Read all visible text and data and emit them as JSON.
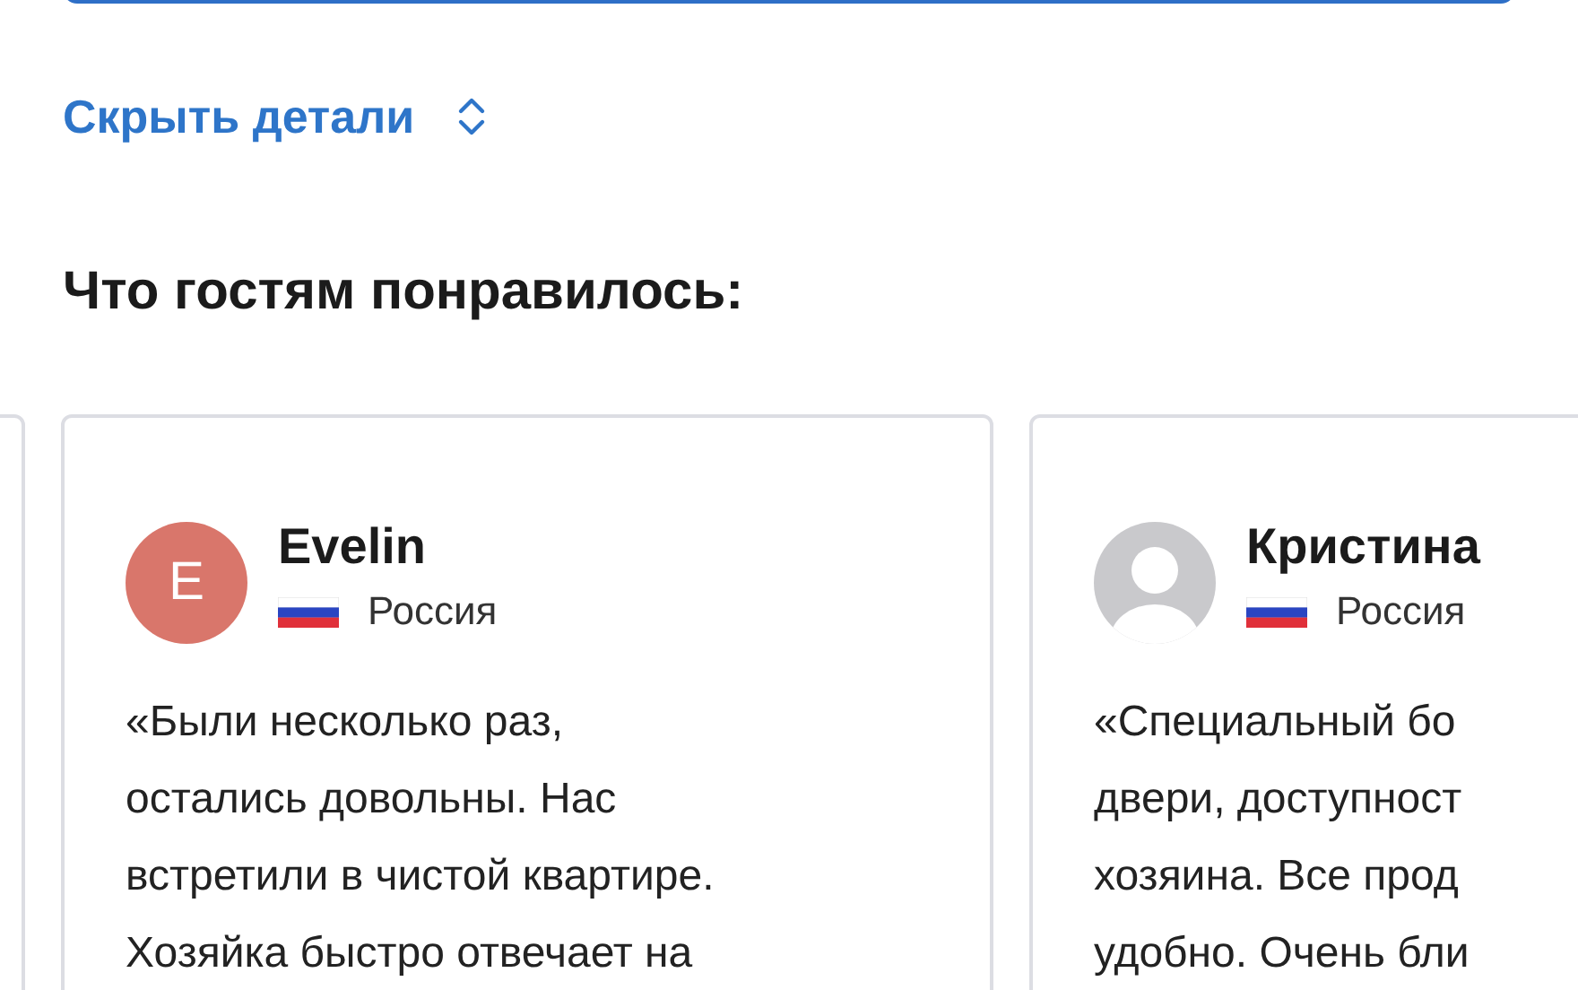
{
  "details_toggle": {
    "label": "Скрыть детали",
    "expanded": true
  },
  "section_title": "Что гостям понравилось:",
  "reviews": [
    {
      "name": "Evelin",
      "country": "Россия",
      "avatar": {
        "kind": "letter",
        "letter": "E",
        "color": "#d9766b"
      },
      "lines": [
        "«Были несколько раз,",
        "остались довольны. Нас",
        "встретили в чистой квартире.",
        "Хозяйка быстро отвечает на"
      ]
    },
    {
      "name": "Кристина",
      "country": "Россия",
      "avatar": {
        "kind": "silhouette"
      },
      "lines": [
        "«Специальный бо",
        "двери, доступност",
        "хозяина. Все прод",
        "удобно. Очень бли"
      ]
    }
  ]
}
